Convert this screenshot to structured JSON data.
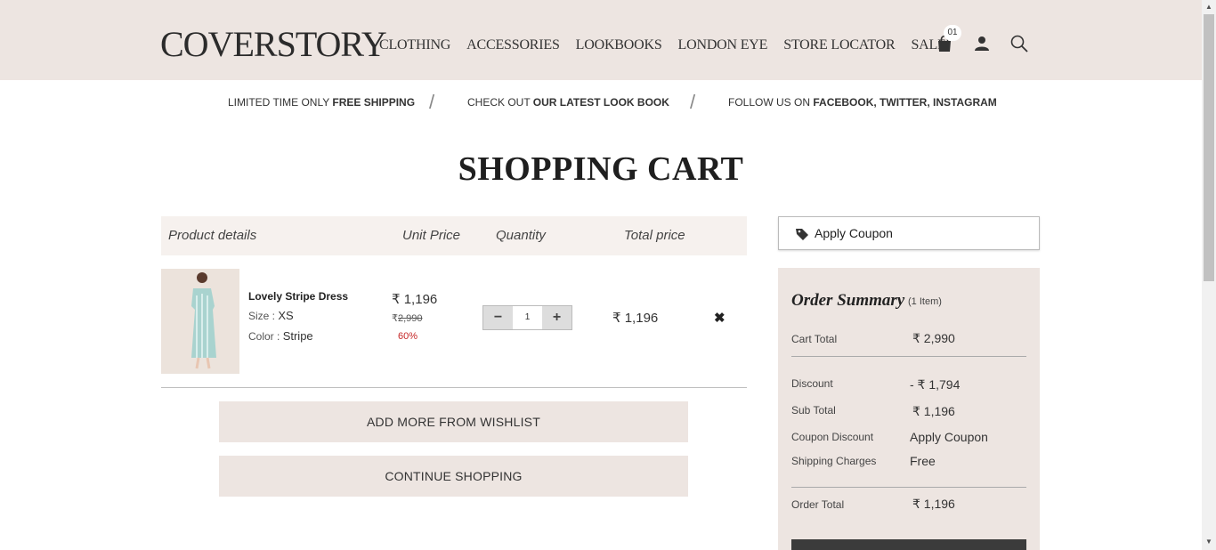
{
  "header": {
    "logo_text": "COVERSTORY",
    "nav": [
      "CLOTHING",
      "ACCESSORIES",
      "LOOKBOOKS",
      "LONDON EYE",
      "STORE LOCATOR",
      "SALE"
    ],
    "cart_count": "01",
    "icons": [
      "shopping-bag-icon",
      "user-icon",
      "search-icon"
    ]
  },
  "promo": {
    "item1_prefix": "LIMITED TIME ONLY",
    "item1_bold": "FREE SHIPPING",
    "item2_prefix": "CHECK OUT",
    "item2_bold": "OUR LATEST LOOK BOOK",
    "item3_prefix": "FOLLOW US ON",
    "item3_bold": "FACEBOOK, TWITTER, INSTAGRAM",
    "separator": "/"
  },
  "page_title": "SHOPPING CART",
  "table": {
    "headers": [
      "Product details",
      "Unit Price",
      "Quantity",
      "Total price"
    ]
  },
  "item": {
    "name": "Lovely Stripe Dress",
    "size_label": "Size :",
    "size_value": "XS",
    "color_label": "Color :",
    "color_value": "Stripe",
    "currency": "₹",
    "unit_price": "1,196",
    "original_price": "2,990",
    "discount_pct": "60%",
    "quantity": "1",
    "total_price": "1,196",
    "minus": "−",
    "plus": "+",
    "remove": "✖"
  },
  "buttons": {
    "wishlist": "ADD MORE FROM WISHLIST",
    "continue": "CONTINUE SHOPPING"
  },
  "coupon": {
    "label": "Apply Coupon"
  },
  "summary": {
    "title": "Order Summary",
    "count": "(1 Item)",
    "cart_total_label": "Cart Total",
    "cart_total": "₹  2,990",
    "discount_label": "Discount",
    "discount": "- ₹  1,794",
    "subtotal_label": "Sub Total",
    "subtotal": "₹  1,196",
    "coupon_discount_label": "Coupon Discount",
    "coupon_discount": "Apply Coupon",
    "shipping_label": "Shipping Charges",
    "shipping": "Free",
    "order_total_label": "Order Total",
    "order_total": "₹  1,196"
  },
  "colors": {
    "header_bg": "#ede5e1",
    "accent_red": "#c62828",
    "dark": "#3b3b3b"
  }
}
